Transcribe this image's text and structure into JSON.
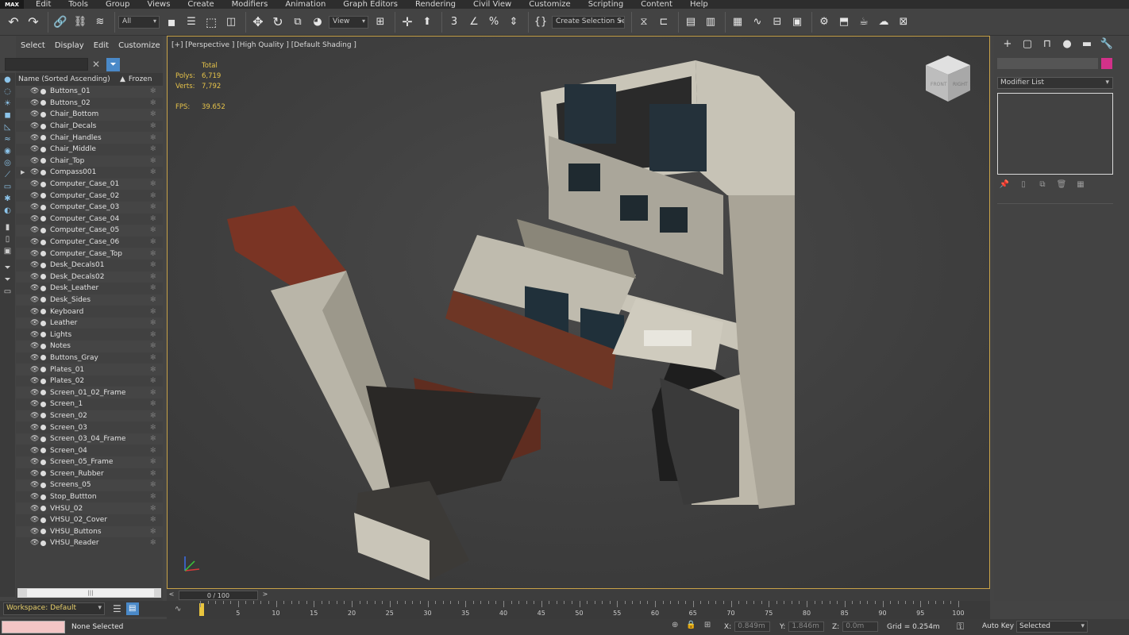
{
  "menubar": {
    "logo": "MAX",
    "items": [
      "Edit",
      "Tools",
      "Group",
      "Views",
      "Create",
      "Modifiers",
      "Animation",
      "Graph Editors",
      "Rendering",
      "Civil View",
      "Customize",
      "Scripting",
      "Content",
      "Help"
    ]
  },
  "toolbar": {
    "filter_value": "All",
    "ref_coord_value": "View",
    "named_selection_placeholder": "Create Selection Se",
    "icons": [
      "undo-icon",
      "redo-icon",
      "link-icon",
      "unlink-icon",
      "bind-space-warp-icon",
      "select-object-icon",
      "select-by-name-icon",
      "rectangular-selection-icon",
      "window-crossing-icon",
      "paint-select-icon",
      "pivot-center-icon",
      "select-move-icon",
      "select-rotate-icon",
      "select-scale-icon",
      "placement-icon",
      "snaps-toggle-icon",
      "angle-snap-icon",
      "percent-snap-icon",
      "spinner-snap-icon",
      "edit-named-sets-icon",
      "mirror-icon",
      "align-icon",
      "scene-explorer-icon",
      "layer-explorer-icon",
      "ribbon-icon",
      "curve-editor-icon",
      "schematic-view-icon",
      "material-editor-icon",
      "render-setup-icon",
      "rendered-frame-icon",
      "render-icon",
      "render-cloud-icon",
      "a360-icon"
    ]
  },
  "scene_explorer": {
    "menu": [
      "Select",
      "Display",
      "Edit",
      "Customize"
    ],
    "search_placeholder": "",
    "clear_glyph": "✕",
    "header_name": "Name (Sorted Ascending)",
    "header_sort": "▲",
    "header_frozen": "Frozen",
    "scroll_grip": "|||",
    "objects": [
      "Buttons_01",
      "Buttons_02",
      "Chair_Bottom",
      "Chair_Decals",
      "Chair_Handles",
      "Chair_Middle",
      "Chair_Top",
      "Compass001",
      "Computer_Case_01",
      "Computer_Case_02",
      "Computer_Case_03",
      "Computer_Case_04",
      "Computer_Case_05",
      "Computer_Case_06",
      "Computer_Case_Top",
      "Desk_Decals01",
      "Desk_Decals02",
      "Desk_Leather",
      "Desk_Sides",
      "Keyboard",
      "Leather",
      "Lights",
      "Notes",
      "Buttons_Gray",
      "Plates_01",
      "Plates_02",
      "Screen_01_02_Frame",
      "Screen_1",
      "Screen_02",
      "Screen_03",
      "Screen_03_04_Frame",
      "Screen_04",
      "Screen_05_Frame",
      "Screen_Rubber",
      "Screens_05",
      "Stop_Buttton",
      "VHSU_02",
      "VHSU_02_Cover",
      "VHSU_Buttons",
      "VHSU_Reader"
    ]
  },
  "workspace": {
    "label": "Workspace: Default"
  },
  "viewport": {
    "label": "[+] [Perspective ] [High Quality ] [Default Shading ]",
    "stats_header": "Total",
    "polys_label": "Polys:",
    "polys_value": "6,719",
    "verts_label": "Verts:",
    "verts_value": "7,792",
    "fps_label": "FPS:",
    "fps_value": "39.652",
    "viewcube_front": "FRONT",
    "viewcube_right": "RIGHT"
  },
  "command_panel": {
    "modifier_list_label": "Modifier List",
    "object_color": "#d23189"
  },
  "timeline": {
    "slider_label": "0 / 100",
    "prev": "<",
    "next": ">",
    "ticks": [
      0,
      5,
      10,
      15,
      20,
      25,
      30,
      35,
      40,
      45,
      50,
      55,
      60,
      65,
      70,
      75,
      80,
      85,
      90,
      95,
      100
    ]
  },
  "status": {
    "selection_text": "None Selected",
    "x_label": "X:",
    "x_value": "0.849m",
    "y_label": "Y:",
    "y_value": "1.846m",
    "z_label": "Z:",
    "z_value": "0.0m",
    "grid": "Grid = 0.254m",
    "autokey": "Auto Key",
    "selected_dd": "Selected"
  },
  "colors": {
    "viewport_border": "#c8a248",
    "stats_text": "#e6c34a",
    "workspace_text": "#e8d06c",
    "status_swatch": "#f3c5c5"
  }
}
